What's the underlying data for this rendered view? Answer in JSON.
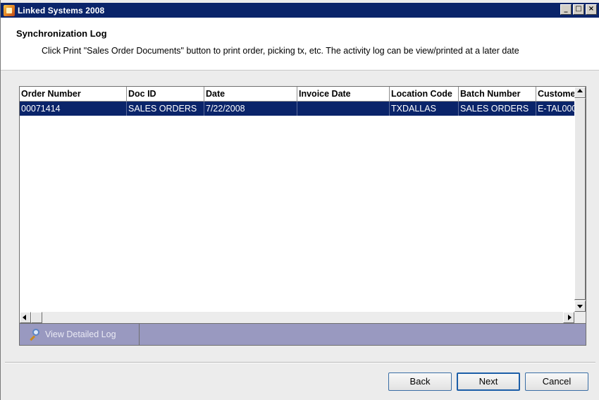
{
  "window": {
    "title": "Linked Systems 2008",
    "controls": {
      "minimize": "_",
      "maximize": "□",
      "close": "×"
    }
  },
  "header": {
    "title": "Synchronization Log",
    "description": "Click Print \"Sales Order Documents\" button to print order, picking tx, etc.  The activity log can be view/printed at a later date"
  },
  "grid": {
    "columns": [
      "Order Number",
      "Doc ID",
      "Date",
      "Invoice Date",
      "Location Code",
      "Batch Number",
      "Custome"
    ],
    "rows": [
      [
        "00071414",
        "SALES ORDERS",
        "7/22/2008",
        "",
        "TXDALLAS",
        "SALES ORDERS",
        "E-TAL000"
      ]
    ]
  },
  "toolbar": {
    "view_log_label": "View Detailed Log",
    "view_log_icon": "magnifier-icon"
  },
  "footer": {
    "back_label": "Back",
    "next_label": "Next",
    "cancel_label": "Cancel"
  },
  "colors": {
    "titlebar": "#0a246a",
    "selected_row": "#0a246a",
    "toolbar_strip": "#9999c0"
  }
}
